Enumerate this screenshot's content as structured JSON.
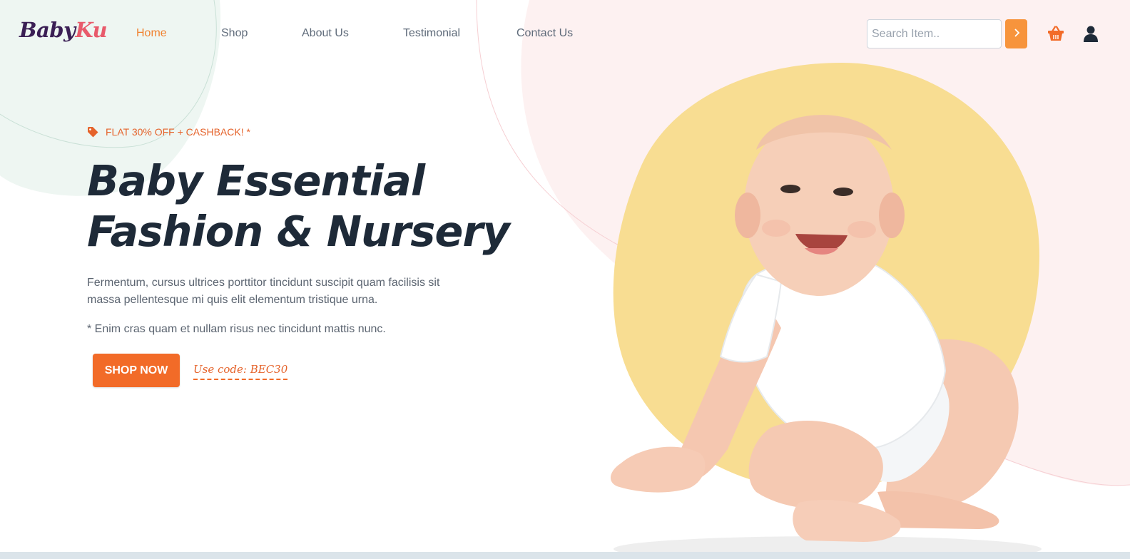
{
  "header": {
    "logo_part1": "Baby",
    "logo_part2": "Ku",
    "nav": [
      "Home",
      "Shop",
      "About Us",
      "Testimonial",
      "Contact Us"
    ],
    "active_nav": "Home",
    "search": {
      "placeholder": "Search Item..",
      "value": ""
    },
    "search_button_icon": "chevron-right-icon",
    "cart_icon": "basket-icon",
    "account_icon": "user-icon"
  },
  "hero": {
    "promo_icon": "tag-icon",
    "promo": "FLAT 30% OFF + CASHBACK! *",
    "headline_line1": "Baby Essential",
    "headline_line2": "Fashion & Nursery",
    "description": "Fermentum, cursus ultrices porttitor tincidunt suscipit quam facilisis sit massa pellentesque mi quis elit elementum tristique urna.",
    "note": "* Enim cras quam et nullam risus nec tincidunt mattis nunc.",
    "cta_label": "SHOP NOW",
    "code_text": "Use code: BEC30"
  },
  "colors": {
    "accent": "#f26b28",
    "nav_active": "#f0812f",
    "heading": "#1e2a38",
    "body_text": "#5b6470",
    "yellow_blob": "#f8dd92",
    "pink_blob": "#fdf1f1",
    "mint_blob": "#eef6f2"
  }
}
